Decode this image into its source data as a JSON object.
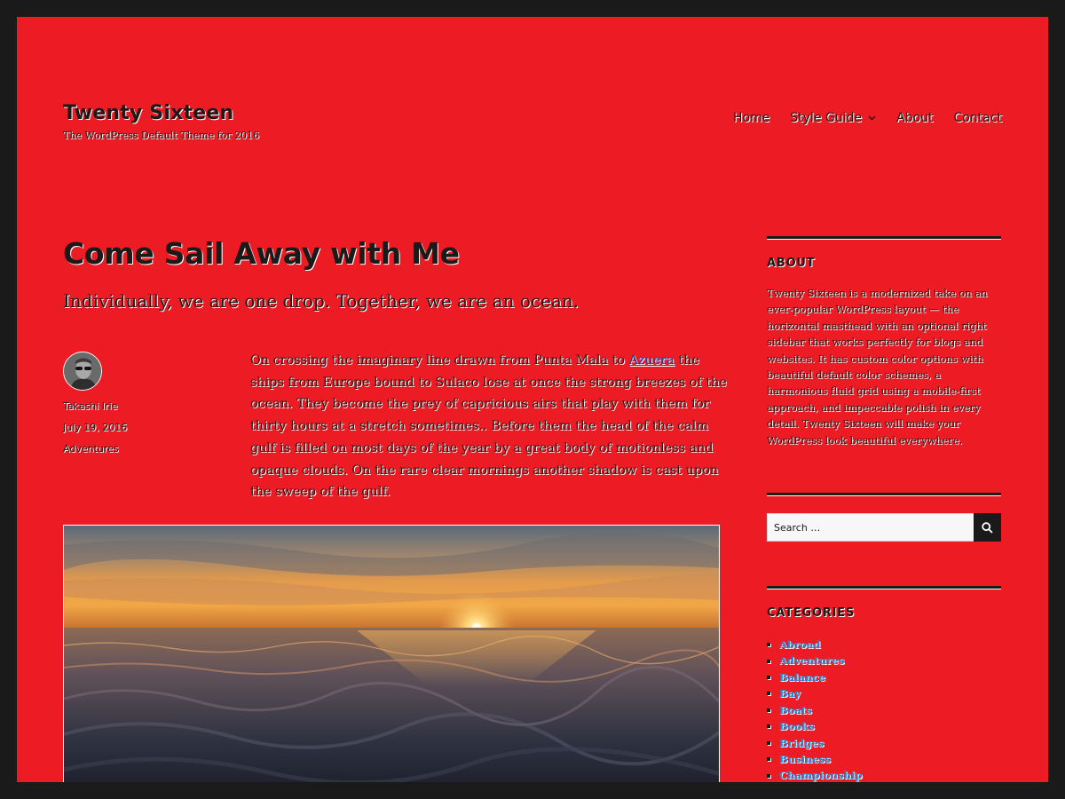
{
  "site": {
    "title": "Twenty Sixteen",
    "description": "The WordPress Default Theme for 2016"
  },
  "nav": {
    "items": [
      {
        "label": "Home"
      },
      {
        "label": "Style Guide",
        "has_submenu": true
      },
      {
        "label": "About"
      },
      {
        "label": "Contact"
      }
    ]
  },
  "post": {
    "title": "Come Sail Away with Me",
    "summary": "Individually, we are one drop. Together, we are an ocean.",
    "author": "Takashi Irie",
    "date": "July 19, 2016",
    "category": "Adventures",
    "content_before_link": "On crossing the imaginary line drawn from Punta Mala to ",
    "content_link": "Azuera",
    "content_after_link": " the ships from Europe bound to Sulaco lose at once the strong breezes of the ocean. They become the prey of capricious airs that play with them for thirty hours at a stretch sometimes.. Before them the head of the calm gulf is filled on most days of the year by a great body of motionless and opaque clouds. On the rare clear mornings another shadow is cast upon the sweep of the gulf."
  },
  "sidebar": {
    "about": {
      "title": "ABOUT",
      "text": "Twenty Sixteen is a modernized take on an ever-popular WordPress layout — the horizontal masthead with an optional right sidebar that works perfectly for blogs and websites. It has custom color options with beautiful default color schemes, a harmonious fluid grid using a mobile-first approach, and impeccable polish in every detail. Twenty Sixteen will make your WordPress look beautiful everywhere."
    },
    "search": {
      "placeholder": "Search …"
    },
    "categories": {
      "title": "CATEGORIES",
      "items": [
        "Abroad",
        "Adventures",
        "Balance",
        "Bay",
        "Boats",
        "Books",
        "Bridges",
        "Business",
        "Championship"
      ]
    }
  },
  "colors": {
    "background": "#ed1c24",
    "frame": "#1a1a1a",
    "text": "#1a1a1a",
    "link": "#1b8be0"
  },
  "icons": {
    "submenu": "chevron-down-icon",
    "search": "search-icon"
  }
}
